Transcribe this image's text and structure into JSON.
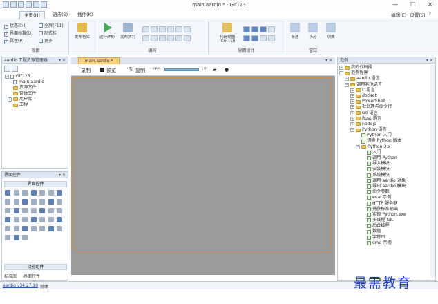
{
  "window": {
    "title": "main.aardio * - Gif123"
  },
  "menu": {
    "tabs": [
      "主页(H)",
      "语法(S)",
      "插件(K)"
    ],
    "right": [
      "编辑(E)",
      "设置(S)"
    ],
    "help": "?"
  },
  "ribbon": {
    "view_checks": [
      "状态栏(I)",
      "全屏(F11)",
      "界面标准(Q)",
      "制式栏",
      "属性(P)",
      "更多"
    ],
    "view_label": "视图",
    "release": "发布仓库",
    "run": "运行(F5)",
    "publish": "发布(F7)",
    "code_label": "编码",
    "codeview": "代码视图",
    "codeview_key": "(Ctrl+U)",
    "ui_label": "界面设计",
    "new": "新建",
    "split": "拆分",
    "switch": "切换",
    "window_label": "窗口"
  },
  "project": {
    "title": "aardio 工程资源管理器",
    "items": [
      "Gif123",
      "main.aardio",
      "资源文件",
      "窗体文件",
      "用户库",
      "工程"
    ]
  },
  "toolbox": {
    "title": "界面控件",
    "section": "界面控件",
    "section2": "功能组件",
    "tab1": "标准库",
    "tab2": "界面控件"
  },
  "editor": {
    "tab": "main.aardio *",
    "toolbar": {
      "record": "录制",
      "preview": "预览",
      "copy": "复制",
      "fps": "FPS:",
      "fps_val": "15"
    }
  },
  "samples": {
    "title": "范例",
    "items": [
      "我的代码段",
      "范例程序",
      "aardio 语言",
      "调用其他语言",
      "C 语言",
      "dotNet",
      "PowerShell",
      "批处理与命令行",
      "Go 语言",
      "Rust 语言",
      "nodejs",
      "Python 语言",
      "Python 入门",
      "切换 Python 版本",
      "Python 3.x",
      "入门",
      "调用 Python",
      "导入模块",
      "安装模块",
      "系统模块",
      "调用 aardio 对象",
      "导出 aardio 模块",
      "命令参数",
      "eval 示例",
      "HTTP 服务器",
      "捕获标准输出",
      "实现 Python.exe",
      "多线程 GIL",
      "后台线程",
      "数值",
      "字符串",
      "cmd 示例"
    ]
  },
  "status": {
    "link": "aardio v34.27.10",
    "text": "就绪"
  },
  "watermark": "最需教育"
}
